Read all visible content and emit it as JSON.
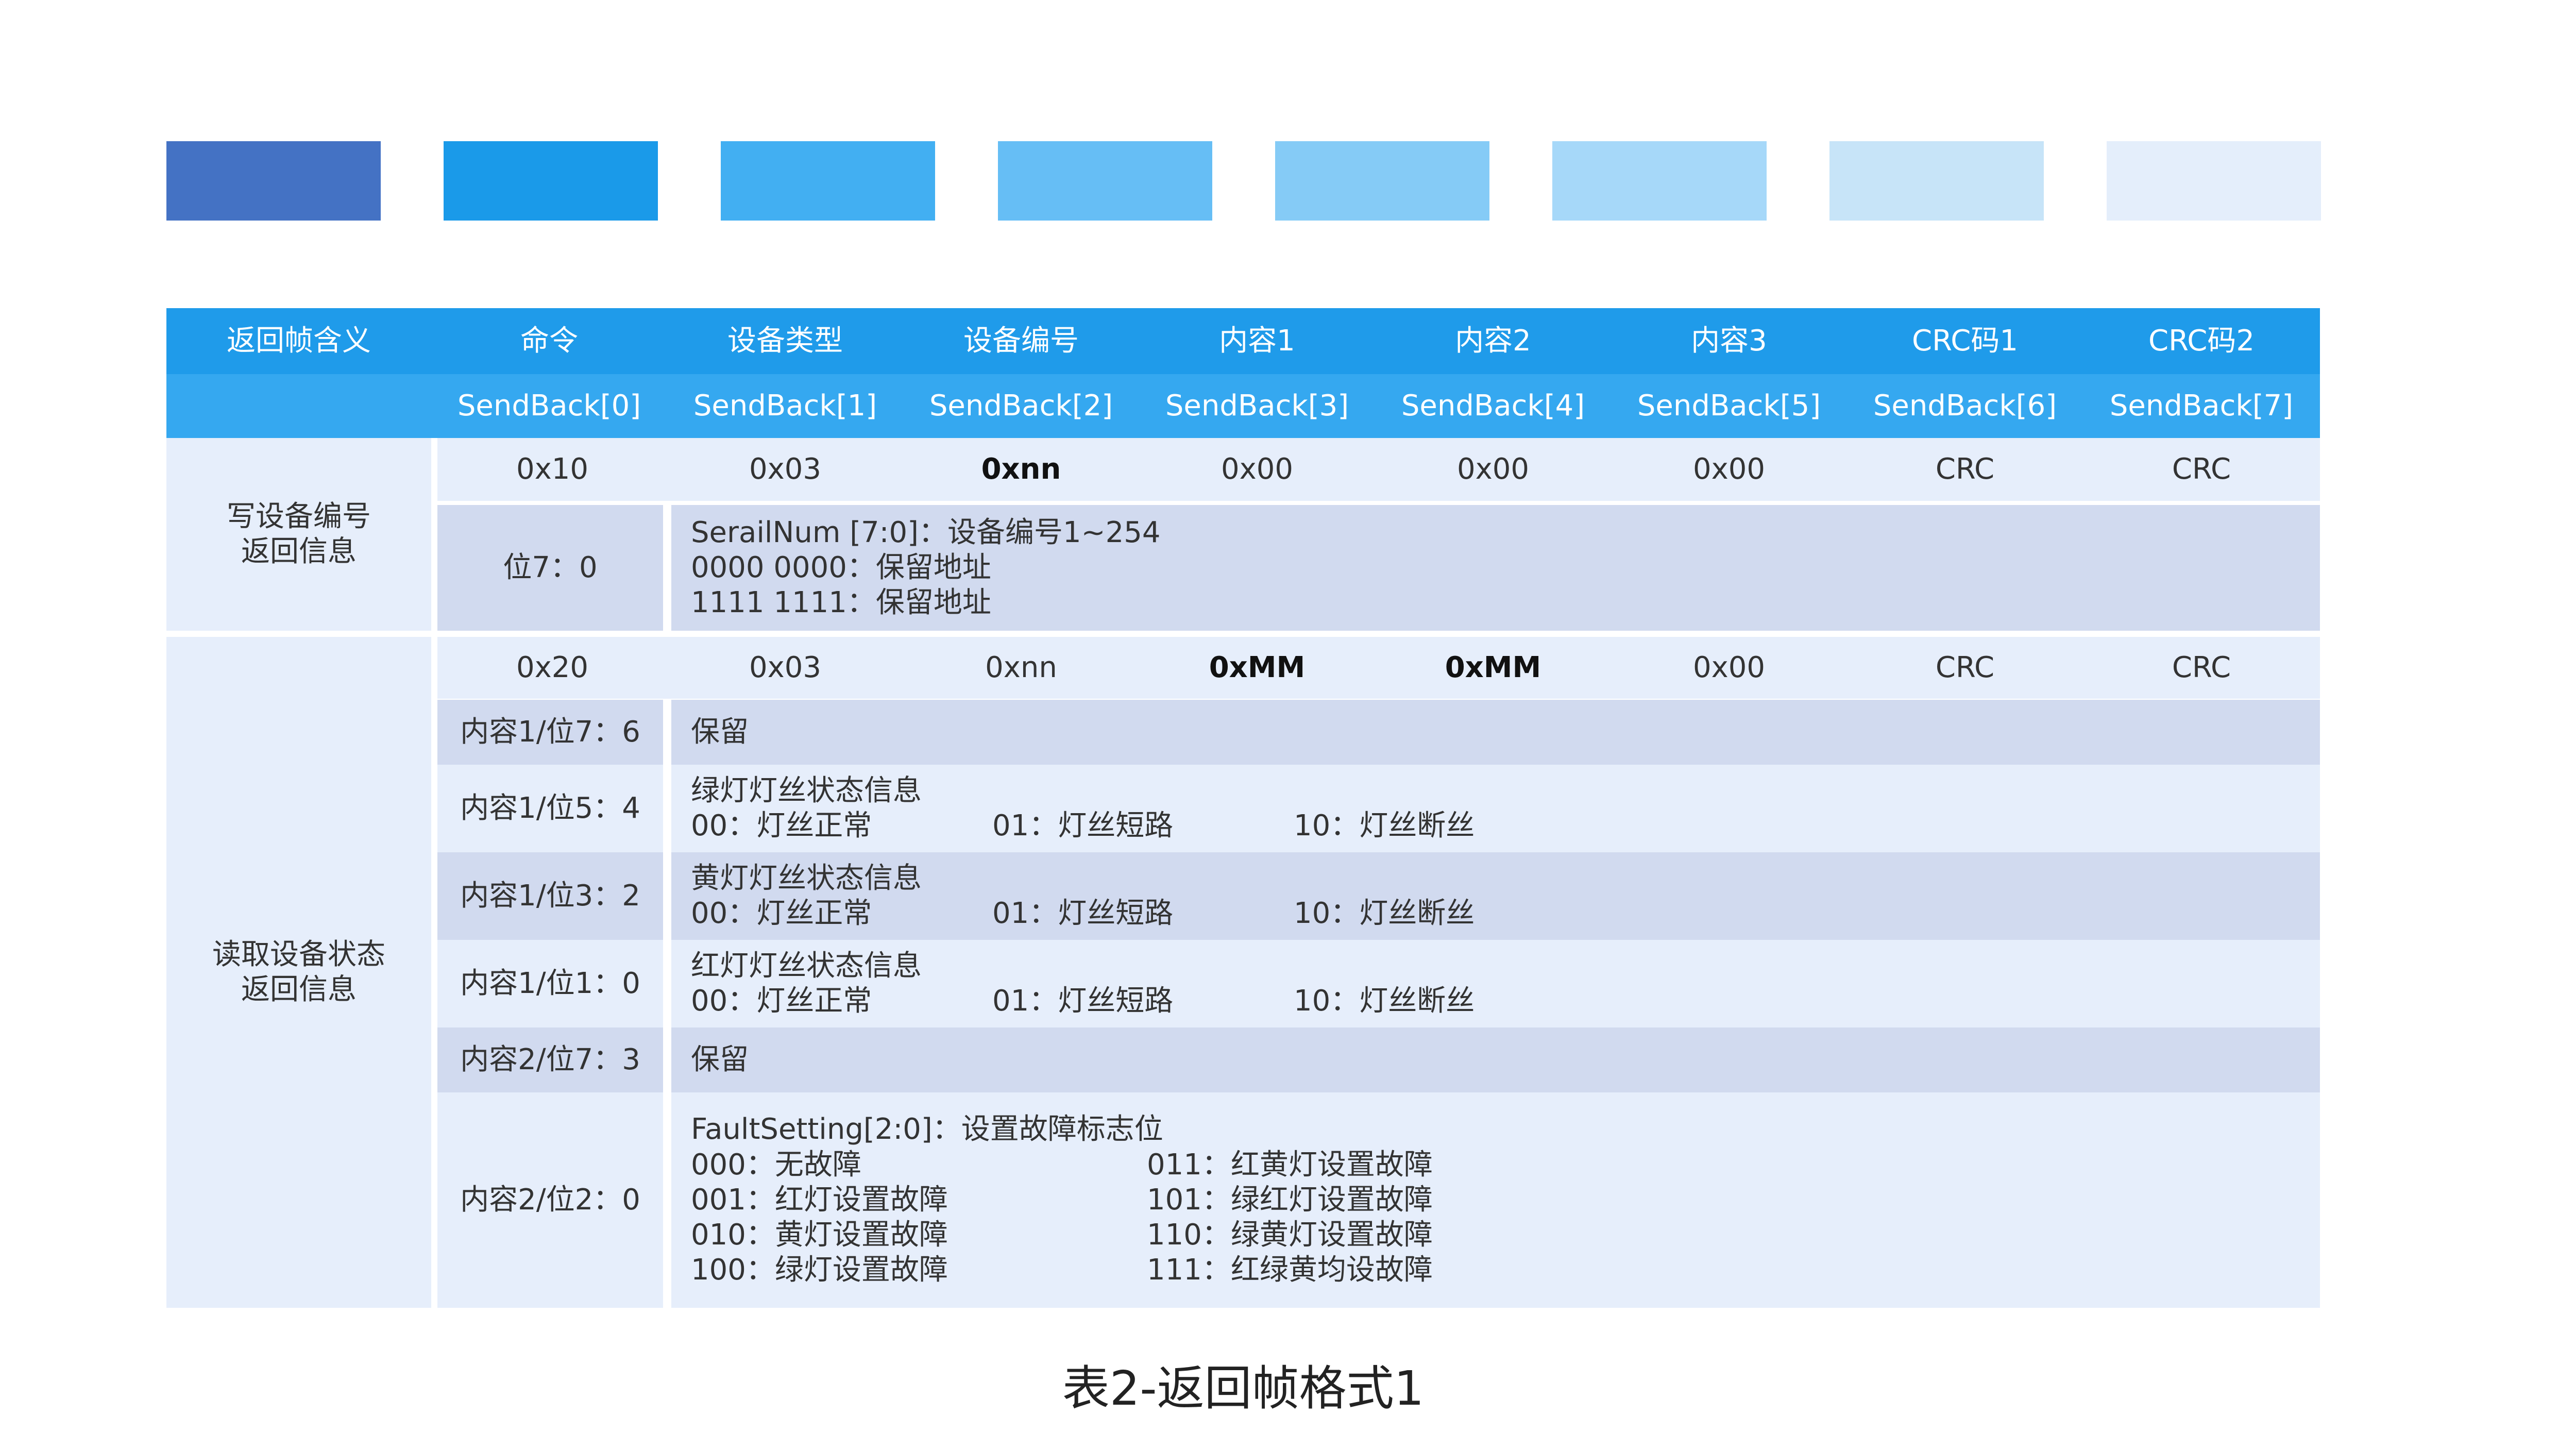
{
  "swatches": [
    "#4472c4",
    "#1a9ae9",
    "#42aff2",
    "#66bef5",
    "#85cbf6",
    "#a6d8f9",
    "#c7e4f8",
    "#e4eefb"
  ],
  "header": {
    "row1": [
      "返回帧含义",
      "命令",
      "设备类型",
      "设备编号",
      "内容1",
      "内容2",
      "内容3",
      "CRC码1",
      "CRC码2"
    ],
    "row2": [
      "",
      "SendBack[0]",
      "SendBack[1]",
      "SendBack[2]",
      "SendBack[3]",
      "SendBack[4]",
      "SendBack[5]",
      "SendBack[6]",
      "SendBack[7]"
    ]
  },
  "section1": {
    "label_line1": "写设备编号",
    "label_line2": "返回信息",
    "values": [
      "0x10",
      "0x03",
      "0xnn",
      "0x00",
      "0x00",
      "0x00",
      "CRC",
      "CRC"
    ],
    "bit_label": "位7：0",
    "desc": [
      "SerailNum [7:0]：设备编号1~254",
      "0000 0000：保留地址",
      "1111 1111：保留地址"
    ]
  },
  "section2": {
    "label_line1": "读取设备状态",
    "label_line2": "返回信息",
    "values": [
      "0x20",
      "0x03",
      "0xnn",
      "0xMM",
      "0xMM",
      "0x00",
      "CRC",
      "CRC"
    ],
    "rows": [
      {
        "label": "内容1/位7：6",
        "title": "保留"
      },
      {
        "label": "内容1/位5：4",
        "title": "绿灯灯丝状态信息",
        "opts": [
          "00：灯丝正常",
          "01：灯丝短路",
          "10：灯丝断丝"
        ]
      },
      {
        "label": "内容1/位3：2",
        "title": "黄灯灯丝状态信息",
        "opts": [
          "00：灯丝正常",
          "01：灯丝短路",
          "10：灯丝断丝"
        ]
      },
      {
        "label": "内容1/位1：0",
        "title": "红灯灯丝状态信息",
        "opts": [
          "00：灯丝正常",
          "01：灯丝短路",
          "10：灯丝断丝"
        ]
      },
      {
        "label": "内容2/位7：3",
        "title": "保留"
      },
      {
        "label": "内容2/位2：0",
        "title": "FaultSetting[2:0]：设置故障标志位",
        "pairs": [
          [
            "000：无故障",
            "011：红黄灯设置故障"
          ],
          [
            "001：红灯设置故障",
            "101：绿红灯设置故障"
          ],
          [
            "010：黄灯设置故障",
            "110：绿黄灯设置故障"
          ],
          [
            "100：绿灯设置故障",
            "111：红绿黄均设故障"
          ]
        ]
      }
    ]
  },
  "caption": "表2-返回帧格式1"
}
